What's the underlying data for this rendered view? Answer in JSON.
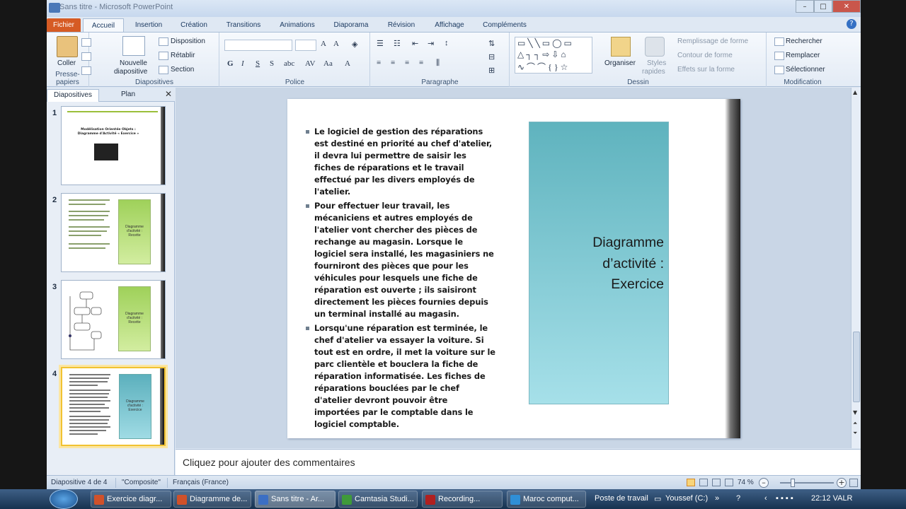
{
  "window": {
    "title": "Sans titre - Microsoft PowerPoint"
  },
  "ribbon_tabs": [
    "Fichier",
    "Accueil",
    "Insertion",
    "Création",
    "Transitions",
    "Animations",
    "Diaporama",
    "Révision",
    "Affichage",
    "Compléments"
  ],
  "ribbon": {
    "clipboard": {
      "paste": "Coller",
      "group": "Presse-papiers"
    },
    "slides": {
      "new_slide_1": "Nouvelle",
      "new_slide_2": "diapositive",
      "layout": "Disposition",
      "reset": "Rétablir",
      "section": "Section",
      "group": "Diapositives"
    },
    "font": {
      "group": "Police"
    },
    "paragraph": {
      "group": "Paragraphe"
    },
    "drawing": {
      "arrange": "Organiser",
      "styles_1": "Styles",
      "styles_2": "rapides",
      "fill": "Remplissage de forme",
      "outline": "Contour de forme",
      "effects": "Effets sur la forme",
      "group": "Dessin"
    },
    "editing": {
      "find": "Rechercher",
      "replace": "Remplacer",
      "select": "Sélectionner",
      "group": "Modification"
    }
  },
  "left_pane": {
    "tabs": [
      "Diapositives",
      "Plan"
    ],
    "thumbnails": [
      {
        "number": "1",
        "title_lines": [
          "Modélisation Orientée Objets :",
          "Diagramme d'Activité « Exercice »"
        ]
      },
      {
        "number": "2",
        "box_text": [
          "Diagramme",
          "d'activité :",
          "Recette"
        ]
      },
      {
        "number": "3",
        "box_text": [
          "Diagramme",
          "d'activité :",
          "Recette"
        ]
      },
      {
        "number": "4",
        "box_text": [
          "Diagramme",
          "d'activité :",
          "Exercice"
        ]
      }
    ]
  },
  "slide": {
    "bullets": [
      "Le logiciel de gestion des réparations est destiné en priorité au chef d'atelier, il devra lui permettre de saisir les fiches de réparations et le travail effectué par les divers employés de l'atelier.",
      " Pour effectuer leur travail, les mécaniciens et autres employés de l'atelier vont chercher des pièces de rechange au magasin. Lorsque le logiciel sera installé, les magasiniers ne fourniront des pièces que pour les véhicules pour lesquels une fiche de réparation est ouverte ; ils saisiront directement les pièces fournies depuis un terminal installé au magasin.",
      "Lorsqu'une réparation est terminée, le chef d'atelier va essayer la voiture. Si tout est en ordre, il met la voiture sur le parc clientèle et bouclera la fiche de réparation informatisée. Les fiches de réparations bouclées par le chef d'atelier devront pouvoir être importées par le comptable dans le logiciel comptable."
    ],
    "title_lines": [
      "Diagramme",
      "d’activité :",
      "Exercice"
    ]
  },
  "notes_placeholder": "Cliquez pour ajouter des commentaires",
  "status": {
    "slide": "Diapositive 4 de 4",
    "theme": "\"Composite\"",
    "language": "Français (France)",
    "zoom": "74 %"
  },
  "taskbar": {
    "items": [
      {
        "label": "Exercice diagr...",
        "color": "#d0512a"
      },
      {
        "label": "Diagramme de...",
        "color": "#d0512a"
      },
      {
        "label": "Sans titre - Ar...",
        "color": "#3c6fc4"
      },
      {
        "label": "Camtasia Studi...",
        "color": "#3f9a3a"
      },
      {
        "label": "Recording...",
        "color": "#b02020"
      },
      {
        "label": "Maroc comput...",
        "color": "#2f8fd6"
      }
    ],
    "toolbar_label": "Poste de travail",
    "drive": "Youssef (C:)",
    "clock": "22:12 VALR"
  }
}
